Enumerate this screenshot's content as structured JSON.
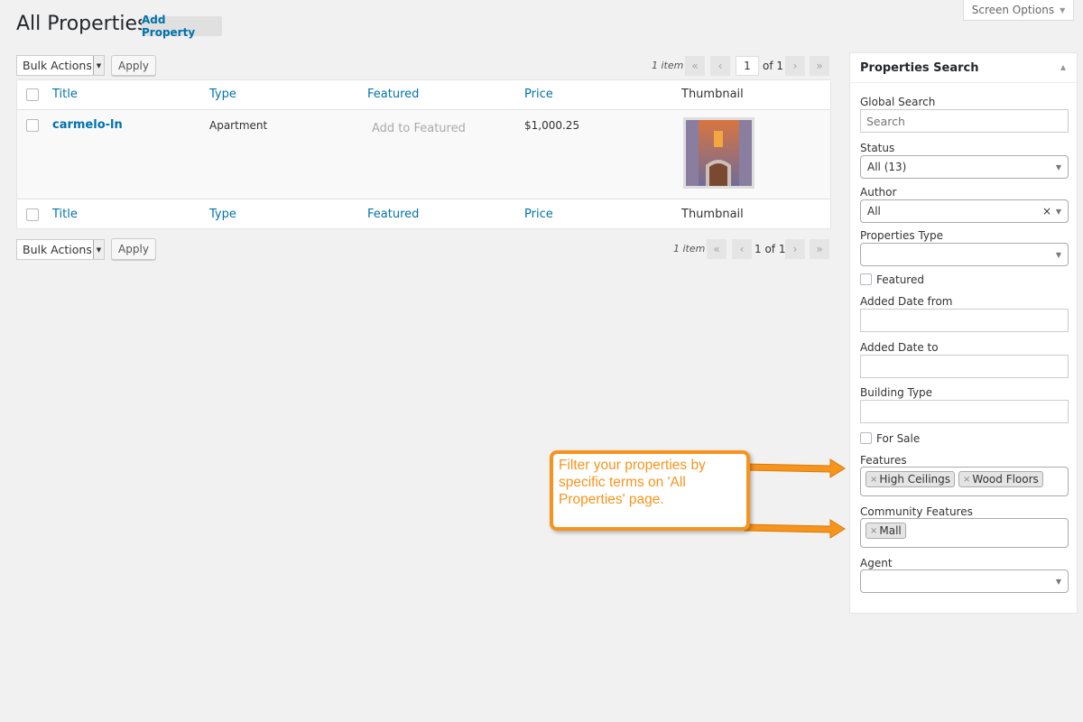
{
  "header": {
    "title": "All Properties",
    "add_button": "Add Property",
    "screen_options": "Screen Options"
  },
  "toolbar": {
    "bulk_actions": "Bulk Actions",
    "apply": "Apply",
    "item_count": "1 item",
    "current_page": "1",
    "of_pages": "of 1",
    "page_display": "1 of 1",
    "first": "«",
    "prev": "‹",
    "next": "›",
    "last": "»"
  },
  "table": {
    "columns": [
      "Title",
      "Type",
      "Featured",
      "Price",
      "Thumbnail"
    ],
    "rows": [
      {
        "title": "carmelo-ln",
        "type": "Apartment",
        "featured": "Add to Featured",
        "price": "$1,000.25",
        "thumbnail_icon": "house-entrance-photo"
      }
    ]
  },
  "sidebar": {
    "title": "Properties Search",
    "global_search_label": "Global Search",
    "global_search_placeholder": "Search",
    "status_label": "Status",
    "status_value": "All (13)",
    "author_label": "Author",
    "author_value": "All",
    "author_clear": "×",
    "properties_type_label": "Properties Type",
    "featured_label": "Featured",
    "added_from_label": "Added Date from",
    "added_to_label": "Added Date to",
    "building_type_label": "Building Type",
    "for_sale_label": "For Sale",
    "features_label": "Features",
    "features": [
      "High Ceilings",
      "Wood Floors"
    ],
    "community_label": "Community Features",
    "community": [
      "Mall"
    ],
    "agent_label": "Agent",
    "tag_remove": "×"
  },
  "callout": {
    "text": "Filter your properties by specific terms on 'All Properties' page.",
    "color": "#f7941d"
  }
}
